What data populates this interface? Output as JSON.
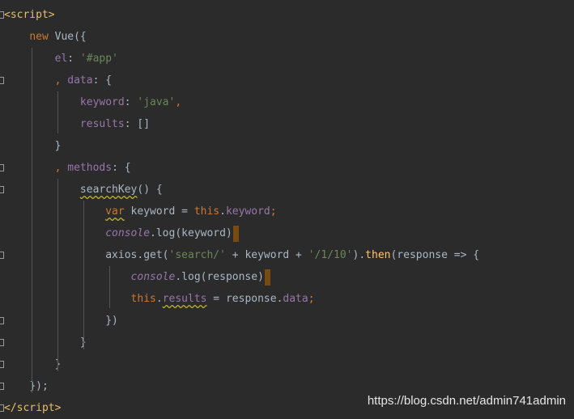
{
  "editor": {
    "lines": [
      {
        "tokens": [
          {
            "t": "<",
            "c": "tok-tag"
          },
          {
            "t": "script",
            "c": "tok-tag"
          },
          {
            "t": ">",
            "c": "tok-tag"
          }
        ]
      },
      {
        "tokens": [
          {
            "t": "    ",
            "c": "tok-plain"
          },
          {
            "t": "new ",
            "c": "tok-kw"
          },
          {
            "t": "Vue",
            "c": "tok-plain"
          },
          {
            "t": "({",
            "c": "tok-plain"
          }
        ]
      },
      {
        "tokens": [
          {
            "t": "        ",
            "c": "tok-plain"
          },
          {
            "t": "el",
            "c": "tok-prop"
          },
          {
            "t": ": ",
            "c": "tok-plain"
          },
          {
            "t": "'#app'",
            "c": "tok-str"
          }
        ]
      },
      {
        "tokens": [
          {
            "t": "        ",
            "c": "tok-plain"
          },
          {
            "t": ", ",
            "c": "tok-kw"
          },
          {
            "t": "data",
            "c": "tok-prop"
          },
          {
            "t": ": {",
            "c": "tok-plain"
          }
        ]
      },
      {
        "tokens": [
          {
            "t": "            ",
            "c": "tok-plain"
          },
          {
            "t": "keyword",
            "c": "tok-prop"
          },
          {
            "t": ": ",
            "c": "tok-plain"
          },
          {
            "t": "'java'",
            "c": "tok-str"
          },
          {
            "t": ",",
            "c": "tok-kw"
          }
        ]
      },
      {
        "tokens": [
          {
            "t": "            ",
            "c": "tok-plain"
          },
          {
            "t": "results",
            "c": "tok-prop"
          },
          {
            "t": ": []",
            "c": "tok-plain"
          }
        ]
      },
      {
        "tokens": [
          {
            "t": "        ",
            "c": "tok-plain"
          },
          {
            "t": "}",
            "c": "tok-plain"
          }
        ]
      },
      {
        "tokens": [
          {
            "t": "        ",
            "c": "tok-plain"
          },
          {
            "t": ", ",
            "c": "tok-kw"
          },
          {
            "t": "methods",
            "c": "tok-prop"
          },
          {
            "t": ": {",
            "c": "tok-plain"
          }
        ]
      },
      {
        "tokens": [
          {
            "t": "            ",
            "c": "tok-plain"
          },
          {
            "t": "searchKey",
            "c": "tok-plain squiggle"
          },
          {
            "t": "() {",
            "c": "tok-plain"
          }
        ]
      },
      {
        "tokens": [
          {
            "t": "                ",
            "c": "tok-plain"
          },
          {
            "t": "var",
            "c": "tok-kw squiggle"
          },
          {
            "t": " keyword = ",
            "c": "tok-plain"
          },
          {
            "t": "this",
            "c": "tok-kw"
          },
          {
            "t": ".",
            "c": "tok-plain"
          },
          {
            "t": "keyword",
            "c": "tok-prop"
          },
          {
            "t": ";",
            "c": "tok-kw"
          }
        ]
      },
      {
        "tokens": [
          {
            "t": "                ",
            "c": "tok-plain"
          },
          {
            "t": "console",
            "c": "tok-italic"
          },
          {
            "t": ".log(keyword)",
            "c": "tok-plain"
          }
        ],
        "cursor": true
      },
      {
        "tokens": [
          {
            "t": "                ",
            "c": "tok-plain"
          },
          {
            "t": "axios.get(",
            "c": "tok-plain"
          },
          {
            "t": "'search/'",
            "c": "tok-str"
          },
          {
            "t": " + keyword + ",
            "c": "tok-plain"
          },
          {
            "t": "'/1/10'",
            "c": "tok-str"
          },
          {
            "t": ").",
            "c": "tok-plain"
          },
          {
            "t": "then",
            "c": "tok-fn"
          },
          {
            "t": "(response => {",
            "c": "tok-plain"
          }
        ]
      },
      {
        "tokens": [
          {
            "t": "                    ",
            "c": "tok-plain"
          },
          {
            "t": "console",
            "c": "tok-italic"
          },
          {
            "t": ".log(response)",
            "c": "tok-plain"
          }
        ],
        "cursor": true
      },
      {
        "tokens": [
          {
            "t": "                    ",
            "c": "tok-plain"
          },
          {
            "t": "this",
            "c": "tok-kw"
          },
          {
            "t": ".",
            "c": "tok-plain"
          },
          {
            "t": "results",
            "c": "tok-prop squiggle"
          },
          {
            "t": " = response.",
            "c": "tok-plain"
          },
          {
            "t": "data",
            "c": "tok-prop"
          },
          {
            "t": ";",
            "c": "tok-kw"
          }
        ]
      },
      {
        "tokens": [
          {
            "t": "                ",
            "c": "tok-plain"
          },
          {
            "t": "})",
            "c": "tok-plain"
          }
        ]
      },
      {
        "tokens": [
          {
            "t": "            ",
            "c": "tok-plain"
          },
          {
            "t": "}",
            "c": "tok-plain"
          }
        ]
      },
      {
        "tokens": [
          {
            "t": "        ",
            "c": "tok-plain"
          },
          {
            "t": "}",
            "c": "tok-plain"
          }
        ]
      },
      {
        "tokens": [
          {
            "t": "    ",
            "c": "tok-plain"
          },
          {
            "t": "});",
            "c": "tok-plain"
          }
        ]
      },
      {
        "tokens": [
          {
            "t": "</",
            "c": "tok-tag"
          },
          {
            "t": "script",
            "c": "tok-tag"
          },
          {
            "t": ">",
            "c": "tok-tag"
          }
        ]
      }
    ]
  },
  "watermark": "https://blog.csdn.net/admin741admin",
  "colors": {
    "background": "#2b2b2b",
    "keyword": "#cc7832",
    "string": "#6a8759",
    "property": "#9876aa",
    "tag": "#e8bf6a",
    "function": "#ffc66d",
    "text": "#a9b7c6"
  }
}
